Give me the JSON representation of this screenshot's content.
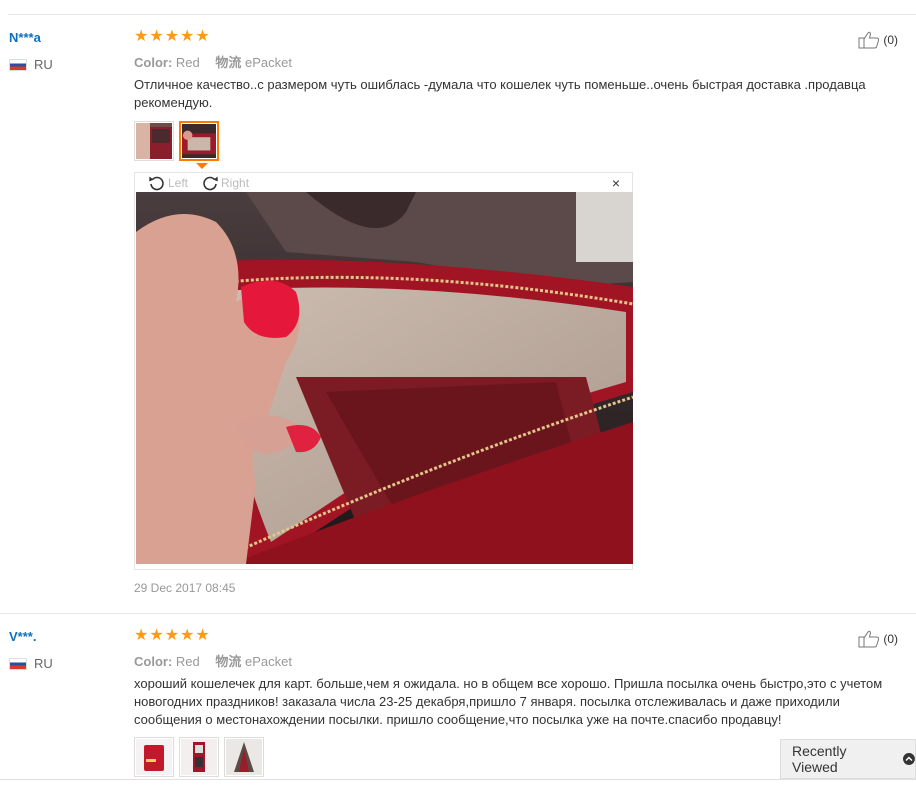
{
  "reviews": [
    {
      "user": "N***a",
      "country": "RU",
      "stars": [
        "★",
        "★",
        "★",
        "★",
        "★"
      ],
      "color_label": "Color:",
      "color_value": "Red",
      "shipping_label": "物流",
      "shipping_value": "ePacket",
      "helpful_count": "(0)",
      "text": "Отличное качество..с размером чуть ошиблась -думала что кошелек чуть поменьше..очень быстрая доставка .продавца рекомендую.",
      "viewer": {
        "left_label": "Left",
        "right_label": "Right",
        "close": "×"
      },
      "date": "29 Dec 2017 08:45"
    },
    {
      "user": "V***.",
      "country": "RU",
      "stars": [
        "★",
        "★",
        "★",
        "★",
        "★"
      ],
      "color_label": "Color:",
      "color_value": "Red",
      "shipping_label": "物流",
      "shipping_value": "ePacket",
      "helpful_count": "(0)",
      "text": "хороший кошелечек для карт. больше,чем я ожидала. но в общем все хорошо. Пришла посылка очень быстро,это с учетом новогодних праздников! заказала числа 23-25 декабря,пришло 7 января. посылка отслеживалась и даже приходили сообщения о местонахождении посылки. пришло сообщение,что посылка уже на почте.спасибо продавцу!"
    }
  ],
  "recently_viewed": {
    "label": "Recently Viewed"
  },
  "colors": {
    "stars": "#ff9a15",
    "username": "#0e6fbd",
    "selected_thumb": "#ff7a00"
  }
}
